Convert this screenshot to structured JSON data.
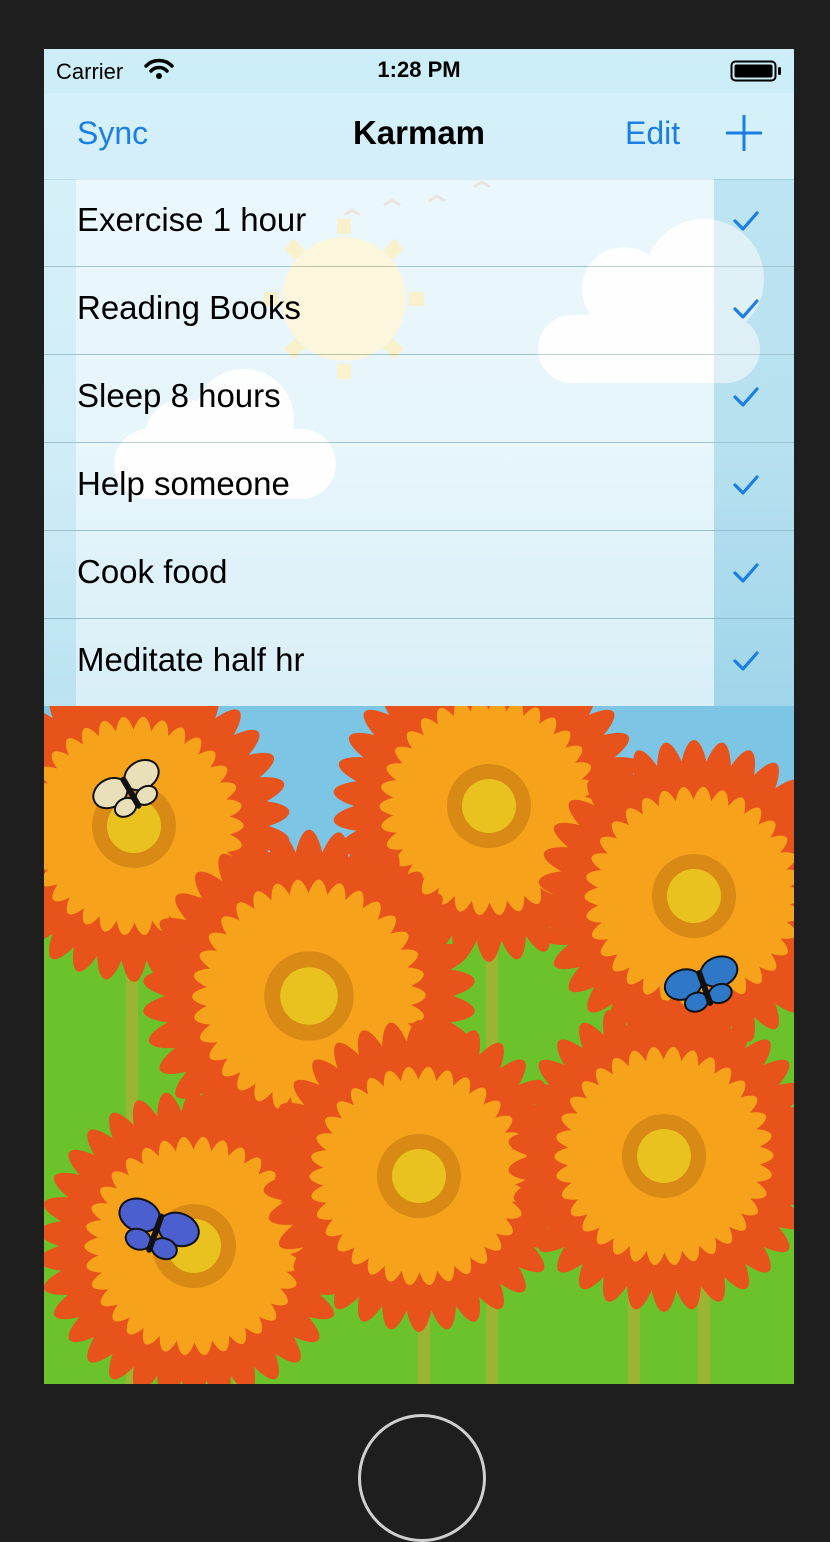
{
  "status_bar": {
    "carrier": "Carrier",
    "time": "1:28 PM",
    "wifi_icon": "wifi-icon",
    "battery_icon": "battery-icon"
  },
  "nav": {
    "left_button": "Sync",
    "title": "Karmam",
    "edit_button": "Edit",
    "add_icon": "plus-icon"
  },
  "tasks": [
    {
      "label": "Exercise 1 hour",
      "checked": true
    },
    {
      "label": "Reading Books",
      "checked": true
    },
    {
      "label": "Sleep 8 hours",
      "checked": true
    },
    {
      "label": "Help someone",
      "checked": true
    },
    {
      "label": "Cook food",
      "checked": true
    },
    {
      "label": "Meditate half hr",
      "checked": true
    }
  ],
  "colors": {
    "accent": "#1a7ee6",
    "petal": "#e8531c",
    "petal_light": "#f6a21b",
    "flower_center": "#e9c21f",
    "grass": "#6cc22a",
    "sky": "#7cc5e4"
  },
  "decor": {
    "flower_icon": "gerbera-flower-icon",
    "butterfly_icon": "butterfly-icon"
  }
}
